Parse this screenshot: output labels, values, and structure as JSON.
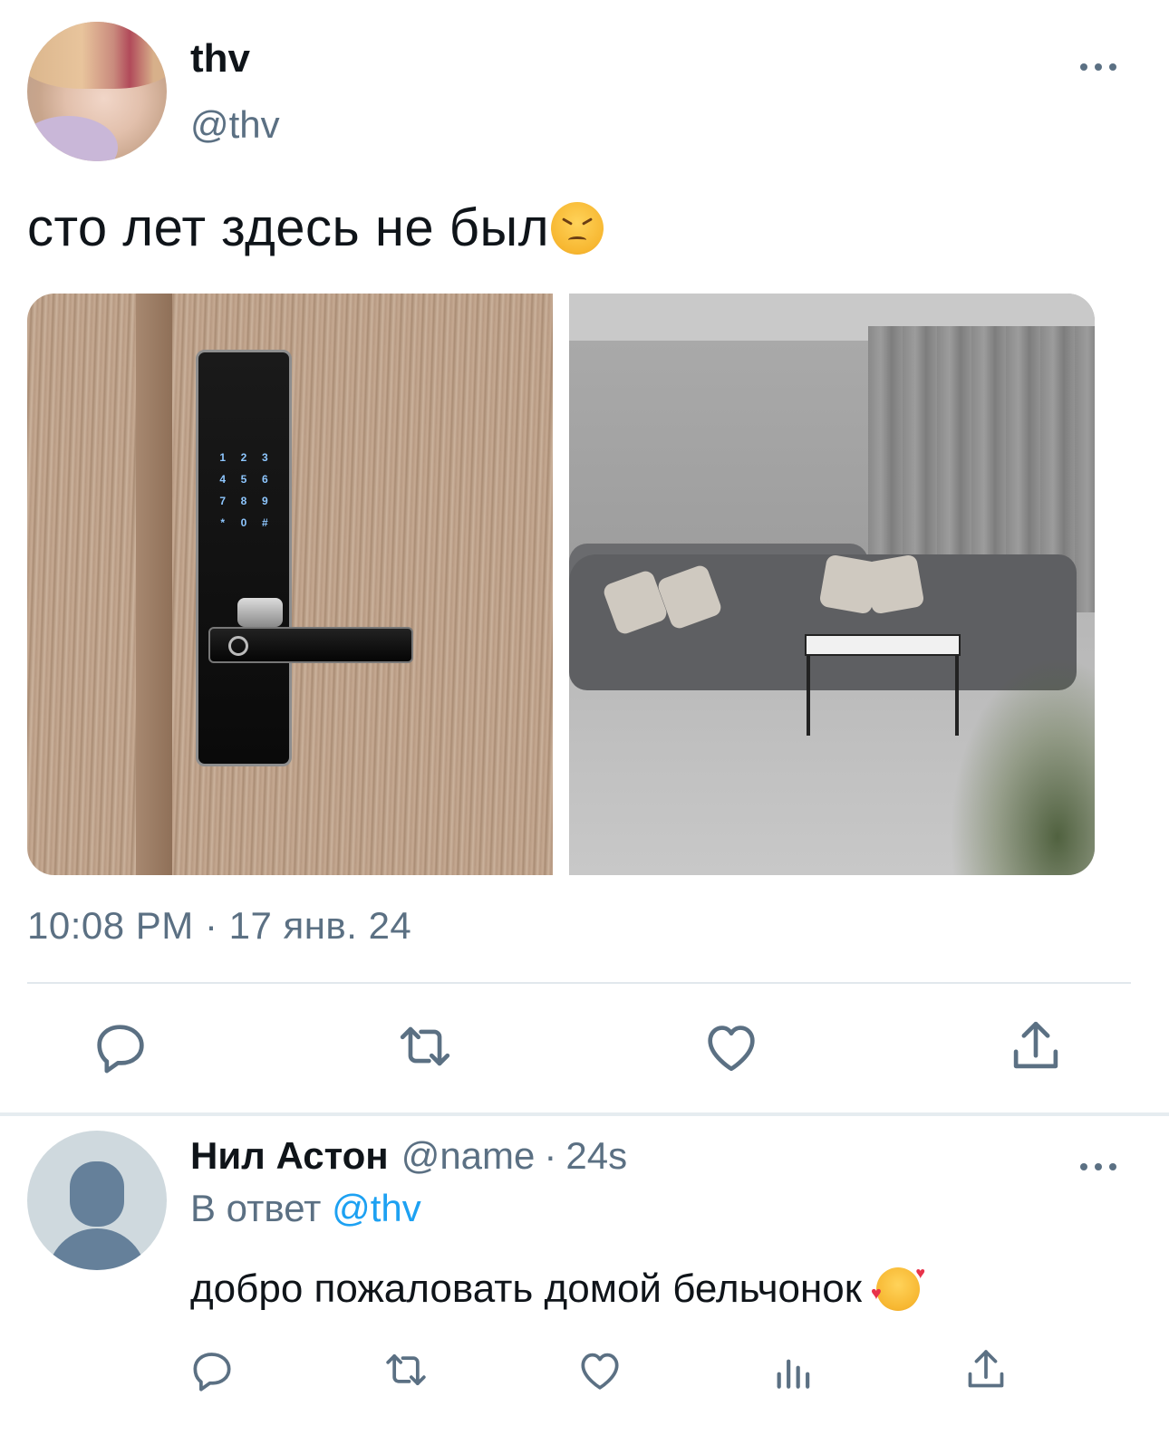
{
  "tweet": {
    "display_name": "thv",
    "handle": "@thv",
    "text": "сто лет здесь не был",
    "emoji": "persevering-face",
    "timestamp": "10:08 PM · 17 янв. 24",
    "media": [
      {
        "name": "door-lock-photo",
        "keypad_keys": [
          "1",
          "2",
          "3",
          "4",
          "5",
          "6",
          "7",
          "8",
          "9",
          "*",
          "0",
          "#"
        ]
      },
      {
        "name": "living-room-photo"
      }
    ],
    "actions": [
      "reply-icon",
      "retweet-icon",
      "like-icon",
      "share-icon"
    ]
  },
  "reply": {
    "display_name": "Нил Астон",
    "handle": "@name",
    "separator": "·",
    "time": "24s",
    "reply_prefix": "В ответ",
    "reply_mention": "@thv",
    "text": "добро пожаловать домой бельчонок",
    "emoji": "smiling-face-with-hearts",
    "actions": [
      "reply-icon",
      "retweet-icon",
      "like-icon",
      "analytics-icon",
      "share-icon"
    ]
  },
  "colors": {
    "text_primary": "#0f1419",
    "text_secondary": "#5b7083",
    "link": "#1da1f2",
    "divider": "#e1e8ed"
  }
}
